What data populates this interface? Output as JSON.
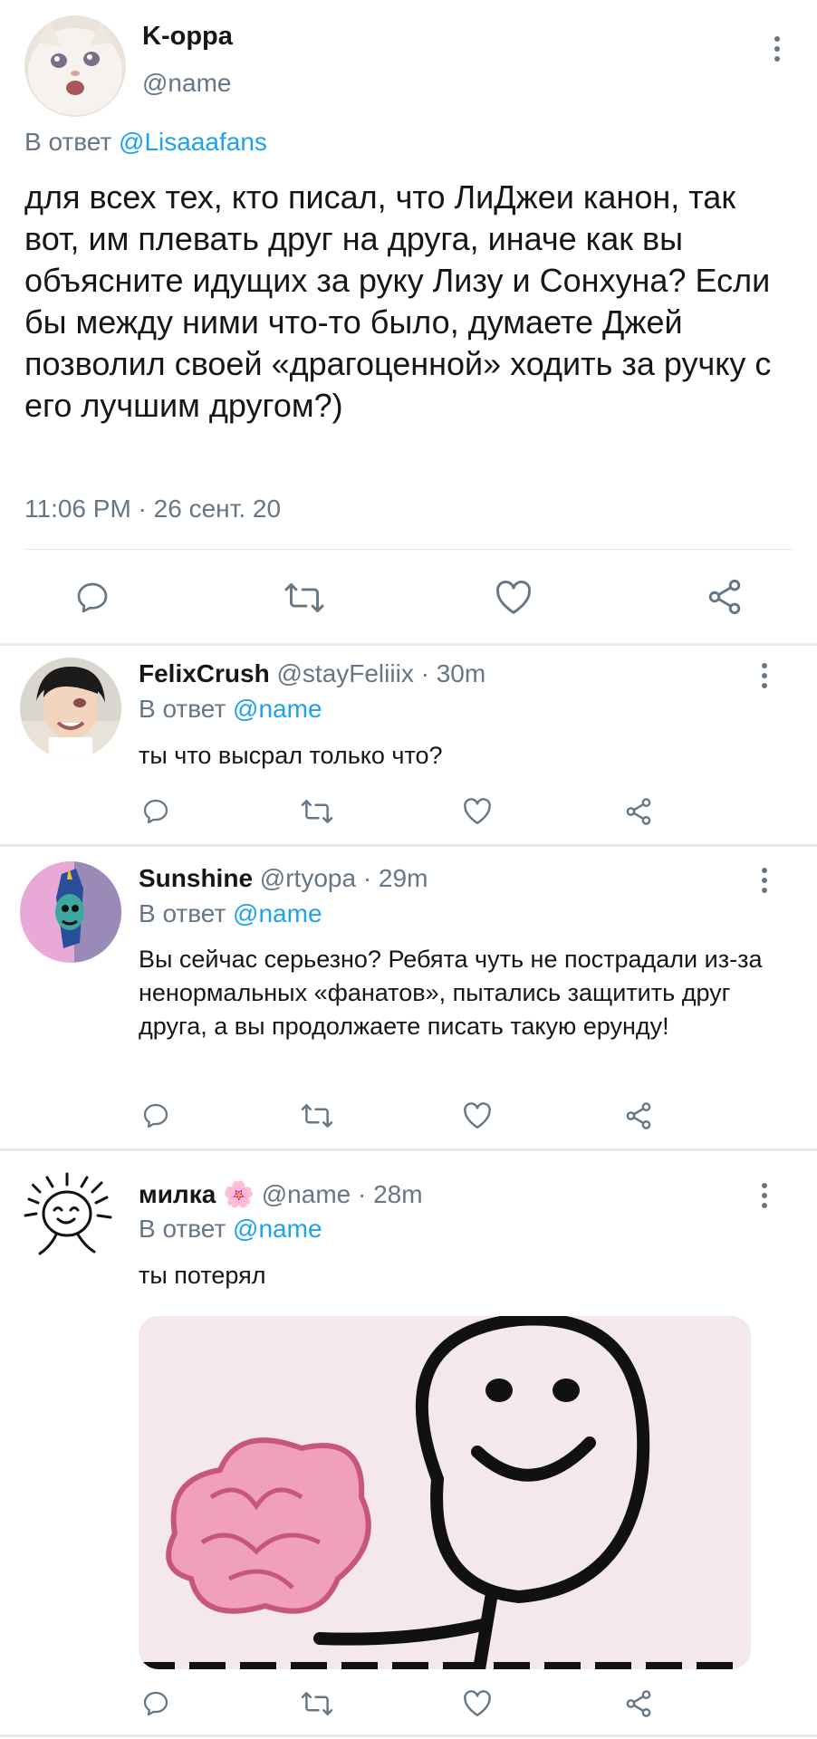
{
  "main_tweet": {
    "name": "K-oppa",
    "handle": "@name",
    "reply_prefix": "В ответ",
    "reply_to": "@Lisaaafans",
    "text": "для всех тех, кто писал, что ЛиДжеи канон, так вот, им плевать друг на друга, иначе как вы объясните идущих за руку Лизу и Сонхуна? Если бы между ними что-то было, думаете Джей позволил своей «драгоценной» ходить за ручку с его лучшим другом?)",
    "timestamp": "11:06 PM · 26 сент. 20"
  },
  "replies": [
    {
      "name": "FelixCrush",
      "handle": "@stayFeliiix",
      "time": "· 30m",
      "reply_prefix": "В ответ",
      "reply_to": "@name",
      "text": "ты что высрал только что?"
    },
    {
      "name": "Sunshine",
      "handle": "@rtyopa",
      "time": "· 29m",
      "reply_prefix": "В ответ",
      "reply_to": "@name",
      "text": "Вы сейчас серьезно? Ребята чуть не пострадали из-за ненормальных «фанатов», пытались защитить друг друга, а вы продолжаете писать такую ерунду!"
    },
    {
      "name": "милка",
      "emoji": "🌸",
      "handle": "@name",
      "time": "· 28m",
      "reply_prefix": "В ответ",
      "reply_to": "@name",
      "text": "ты потерял"
    }
  ],
  "icons": {
    "reply": "comment-bubble-icon",
    "retweet": "retweet-icon",
    "like": "heart-icon",
    "share": "share-icon",
    "more": "more-vertical-icon"
  },
  "colors": {
    "link": "#1da1f2",
    "secondary_text": "#657786",
    "icon": "#657786",
    "divider": "#e1e8ed"
  }
}
